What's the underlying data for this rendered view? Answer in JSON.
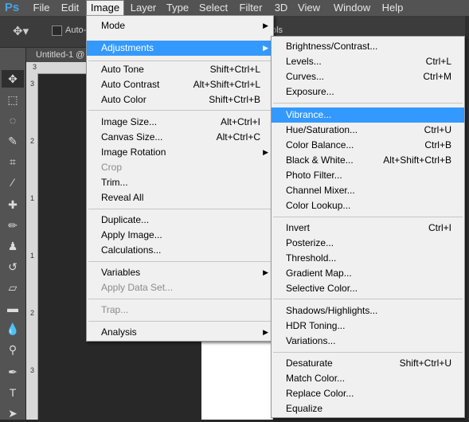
{
  "app_logo": "Ps",
  "menubar": [
    "File",
    "Edit",
    "Image",
    "Layer",
    "Type",
    "Select",
    "Filter",
    "3D",
    "View",
    "Window",
    "Help"
  ],
  "options_bar": {
    "auto_select_label": "Auto-",
    "partial_text": "ols"
  },
  "document_tab": "Untitled-1 @",
  "ruler": {
    "h_mark": "3",
    "v_marks": [
      "3",
      "2",
      "1",
      "1",
      "2",
      "3",
      "4",
      "5"
    ]
  },
  "image_menu": {
    "items": [
      {
        "label": "Mode",
        "arrow": true
      },
      {
        "label": "Adjustments",
        "arrow": true,
        "highlighted": true
      },
      {
        "label": "Auto Tone",
        "shortcut": "Shift+Ctrl+L"
      },
      {
        "label": "Auto Contrast",
        "shortcut": "Alt+Shift+Ctrl+L"
      },
      {
        "label": "Auto Color",
        "shortcut": "Shift+Ctrl+B"
      },
      {
        "label": "Image Size...",
        "shortcut": "Alt+Ctrl+I"
      },
      {
        "label": "Canvas Size...",
        "shortcut": "Alt+Ctrl+C"
      },
      {
        "label": "Image Rotation",
        "arrow": true
      },
      {
        "label": "Crop",
        "disabled": true
      },
      {
        "label": "Trim..."
      },
      {
        "label": "Reveal All"
      },
      {
        "label": "Duplicate..."
      },
      {
        "label": "Apply Image..."
      },
      {
        "label": "Calculations..."
      },
      {
        "label": "Variables",
        "arrow": true
      },
      {
        "label": "Apply Data Set...",
        "disabled": true
      },
      {
        "label": "Trap...",
        "disabled": true
      },
      {
        "label": "Analysis",
        "arrow": true
      }
    ]
  },
  "adjustments_menu": {
    "items": [
      {
        "label": "Brightness/Contrast..."
      },
      {
        "label": "Levels...",
        "shortcut": "Ctrl+L"
      },
      {
        "label": "Curves...",
        "shortcut": "Ctrl+M"
      },
      {
        "label": "Exposure..."
      },
      {
        "label": "Vibrance...",
        "highlighted": true
      },
      {
        "label": "Hue/Saturation...",
        "shortcut": "Ctrl+U"
      },
      {
        "label": "Color Balance...",
        "shortcut": "Ctrl+B"
      },
      {
        "label": "Black & White...",
        "shortcut": "Alt+Shift+Ctrl+B"
      },
      {
        "label": "Photo Filter..."
      },
      {
        "label": "Channel Mixer..."
      },
      {
        "label": "Color Lookup..."
      },
      {
        "label": "Invert",
        "shortcut": "Ctrl+I"
      },
      {
        "label": "Posterize..."
      },
      {
        "label": "Threshold..."
      },
      {
        "label": "Gradient Map..."
      },
      {
        "label": "Selective Color..."
      },
      {
        "label": "Shadows/Highlights..."
      },
      {
        "label": "HDR Toning..."
      },
      {
        "label": "Variations..."
      },
      {
        "label": "Desaturate",
        "shortcut": "Shift+Ctrl+U"
      },
      {
        "label": "Match Color..."
      },
      {
        "label": "Replace Color..."
      },
      {
        "label": "Equalize"
      }
    ]
  },
  "colors": {
    "highlight": "#3399ff",
    "menu_bg": "#f0f0f0",
    "ui_dark": "#535353"
  },
  "tool_icons": [
    "move-icon",
    "marquee-icon",
    "lasso-icon",
    "quick-select-icon",
    "crop-icon",
    "eyedropper-icon",
    "healing-brush-icon",
    "brush-icon",
    "clone-stamp-icon",
    "history-brush-icon",
    "eraser-icon",
    "gradient-icon",
    "blur-icon",
    "dodge-icon",
    "pen-icon",
    "type-icon",
    "path-select-icon"
  ]
}
